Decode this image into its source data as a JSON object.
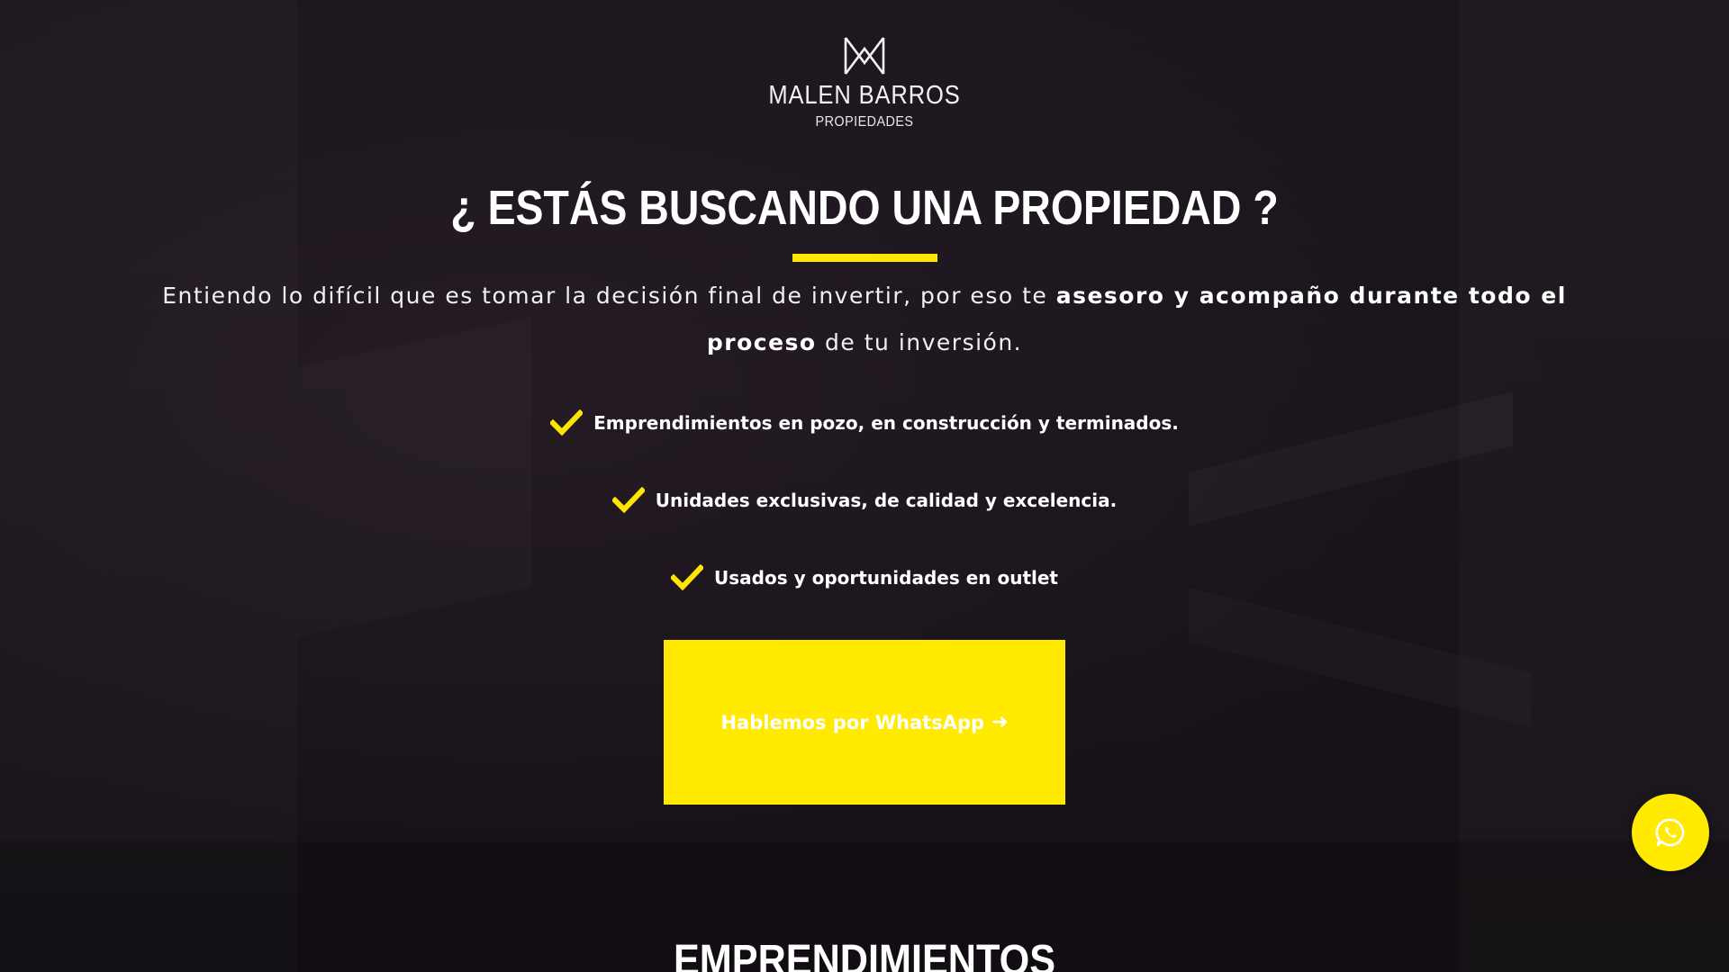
{
  "brand": {
    "name": "MALEN BARROS",
    "subtitle": "PROPIEDADES"
  },
  "hero": {
    "headline": "¿ ESTÁS BUSCANDO UNA PROPIEDAD ?",
    "intro_part1": "Entiendo lo difícil que es tomar la decisión final de invertir, por eso te ",
    "intro_bold": "asesoro y acompaño durante todo el proceso",
    "intro_part2": " de tu inversión.",
    "features": [
      "Emprendimientos en pozo, en construcción y terminados.",
      "Unidades exclusivas, de calidad y excelencia.",
      "Usados y oportunidades en outlet"
    ],
    "cta_label": "Hablemos por WhatsApp"
  },
  "next_section": {
    "title": "EMPRENDIMIENTOS"
  },
  "colors": {
    "accent": "#ffea00",
    "background": "#17131a",
    "text": "#ffffff"
  },
  "icons": {
    "logo": "m-monogram-logo",
    "feature": "check-icon",
    "cta": "arrow-right-icon",
    "fab": "whatsapp-icon"
  }
}
